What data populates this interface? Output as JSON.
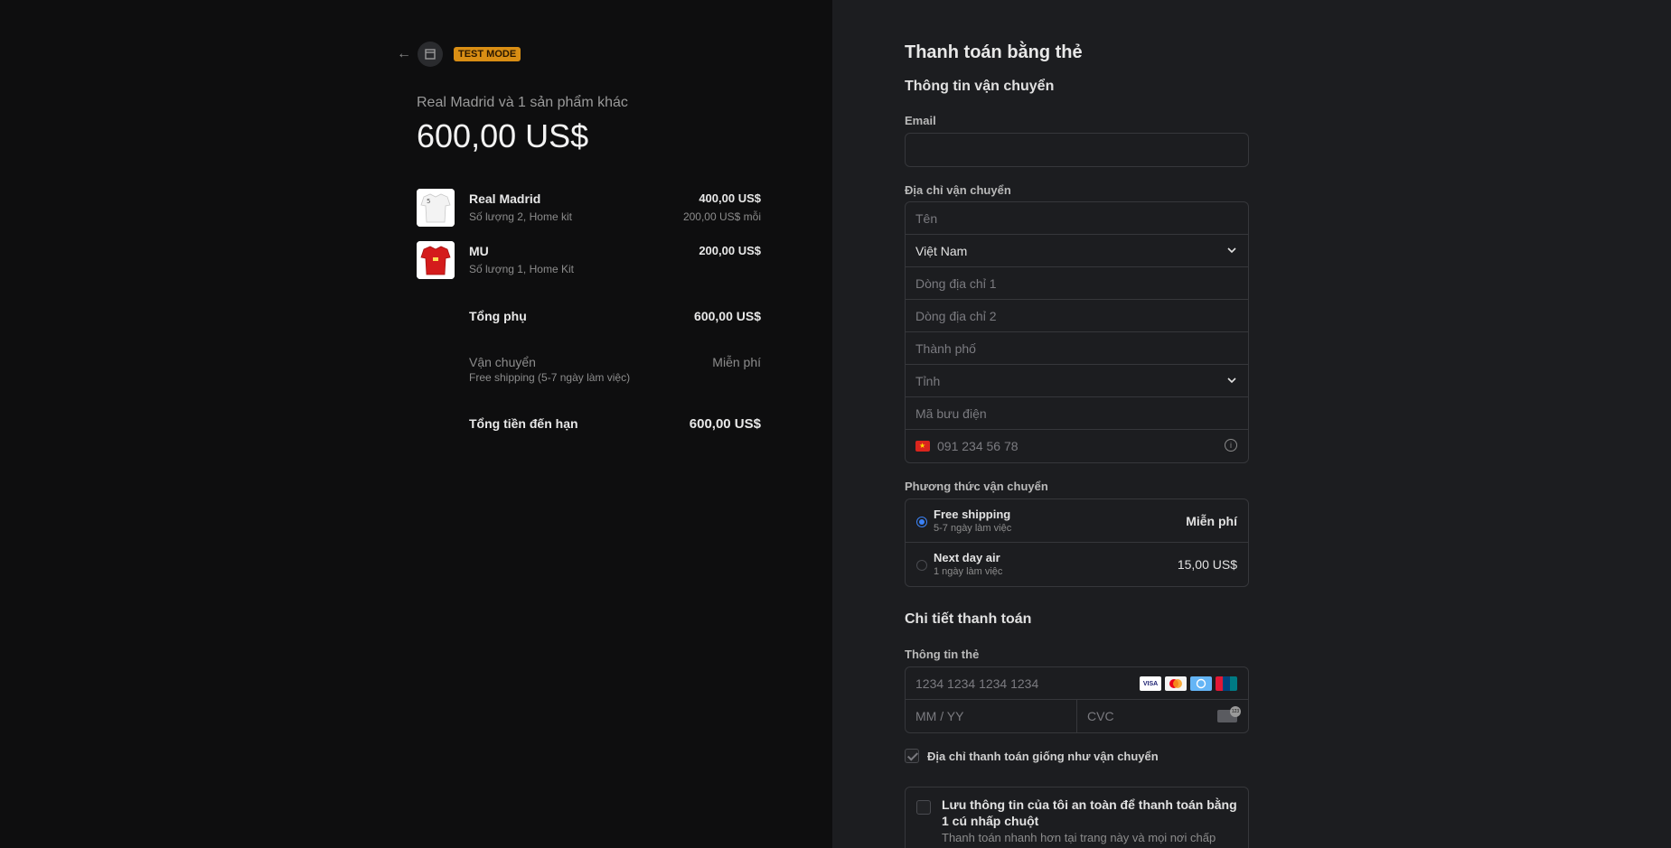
{
  "summary": {
    "test_mode": "TEST MODE",
    "order_title": "Real Madrid và 1 sản phẩm khác",
    "order_total": "600,00 US$",
    "items": [
      {
        "name": "Real Madrid",
        "desc": "Số lượng 2, Home kit",
        "price": "400,00 US$",
        "unit": "200,00 US$ mỗi"
      },
      {
        "name": "MU",
        "desc": "Số lượng 1, Home Kit",
        "price": "200,00 US$",
        "unit": ""
      }
    ],
    "subtotal_label": "Tổng phụ",
    "subtotal_value": "600,00 US$",
    "shipping_label": "Vận chuyển",
    "shipping_sub": "Free shipping (5-7 ngày làm việc)",
    "shipping_value": "Miễn phí",
    "total_due_label": "Tổng tiền đến hạn",
    "total_due_value": "600,00 US$"
  },
  "form": {
    "title": "Thanh toán bằng thẻ",
    "shipping_info_title": "Thông tin vận chuyển",
    "email_label": "Email",
    "email_value": "",
    "address_label": "Địa chỉ vận chuyển",
    "name_placeholder": "Tên",
    "country_value": "Việt Nam",
    "line1_placeholder": "Dòng địa chỉ 1",
    "line2_placeholder": "Dòng địa chỉ 2",
    "city_placeholder": "Thành phố",
    "province_placeholder": "Tỉnh",
    "postal_placeholder": "Mã bưu điện",
    "phone_placeholder": "091 234 56 78",
    "shipping_method_label": "Phương thức vận chuyển",
    "shipping_options": [
      {
        "name": "Free shipping",
        "sub": "5-7 ngày làm việc",
        "price": "Miễn phí"
      },
      {
        "name": "Next day air",
        "sub": "1 ngày làm việc",
        "price": "15,00 US$"
      }
    ],
    "payment_title": "Chi tiết thanh toán",
    "card_label": "Thông tin thẻ",
    "card_number_placeholder": "1234 1234 1234 1234",
    "expiry_placeholder": "MM / YY",
    "cvc_placeholder": "CVC",
    "card_brands": [
      "VISA",
      "mastercard",
      "diners",
      "unionpay"
    ],
    "billing_same_label": "Địa chỉ thanh toán giống như vận chuyển",
    "save_title": "Lưu thông tin của tôi an toàn để thanh toán bằng 1 cú nhấp chuột",
    "save_desc": "Thanh toán nhanh hơn tại trang này và mọi nơi chấp"
  },
  "colors": {
    "left_bg": "#0e0e0f",
    "right_bg": "#1c1d20",
    "badge": "#d98e14",
    "accent": "#3b82f6"
  }
}
